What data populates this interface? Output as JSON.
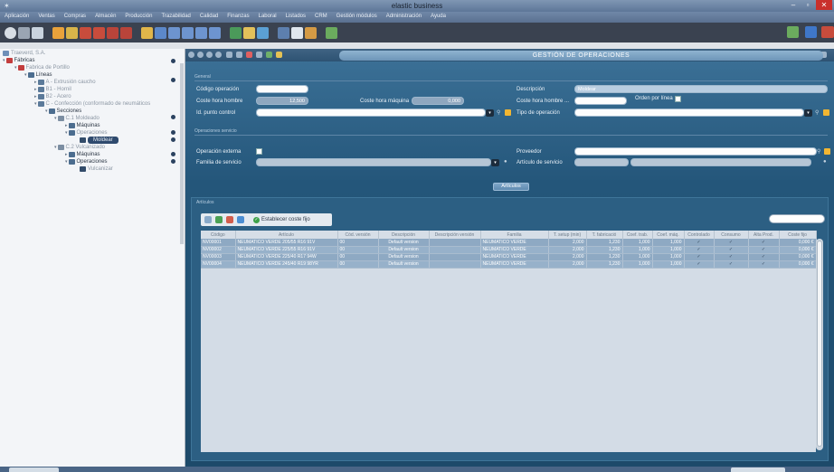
{
  "window": {
    "title": "elastic business",
    "logo_glyph": "✶",
    "minimize": "–",
    "maximize": "▫",
    "close": "✕"
  },
  "menu": [
    "Aplicación",
    "Ventas",
    "Compras",
    "Almacén",
    "Producción",
    "Trazabilidad",
    "Calidad",
    "Finanzas",
    "Laboral",
    "Listados",
    "CRM",
    "Gestión módulos",
    "Administración",
    "Ayuda"
  ],
  "tree": {
    "root": "Traeverd, S.A.",
    "fabricas": "Fábricas",
    "fabrica": "Fabrica de Portillo",
    "lineas": "Líneas",
    "linea_a": "A - Extrusión caucho",
    "linea_b1": "B1 - Hornil",
    "linea_b2": "B2 - Acero",
    "linea_c": "C - Confección (conformado de neumáticos",
    "secciones": "Secciones",
    "c1": "C.1 Moldeado",
    "maquinas1": "Máquinas",
    "operaciones1": "Operaciones",
    "moldear": "Moldear",
    "c2": "C.2 Vulcanizado",
    "maquinas2": "Máquinas",
    "operaciones2": "Operaciones",
    "vulcanizar": "Vulcanizar"
  },
  "panel": {
    "title": "GESTIÓN DE OPERACIONES"
  },
  "form": {
    "section_general": "General",
    "codigo_operacion_label": "Código operación",
    "codigo_operacion_value": "",
    "descripcion_label": "Descripción",
    "descripcion_value": "Moldear",
    "coste_hora_hombre_label": "Coste hora hombre",
    "coste_hora_hombre_value": "12,500",
    "coste_hora_maquina_label": "Coste hora máquina",
    "coste_hora_maquina_value": "0,000",
    "coste_hora_hombre2_label": "Coste hora hombre ...",
    "orden_por_linea_label": "Orden por línea",
    "id_punto_control_label": "Id. punto control",
    "tipo_operacion_label": "Tipo de operación",
    "section_servicio": "Operaciones servicio",
    "operacion_externa_label": "Operación externa",
    "proveedor_label": "Proveedor",
    "familia_servicio_label": "Familia de servicio",
    "articulo_servicio_label": "Artículo de servicio",
    "articulos_button": "Artículos"
  },
  "articulos": {
    "section": "Artículos",
    "establecer_coste_fijo": "Establecer coste fijo",
    "columns": [
      "Código",
      "Artículo",
      "Cód. versión",
      "Descripción",
      "Descripción versión",
      "Familia",
      "T. setup (min)",
      "T. fabricació",
      "Coef. trab.",
      "Coef. máq.",
      "Controlado",
      "Consumo",
      "Alta Prod.",
      "Coste fijo"
    ],
    "rows": [
      [
        "NV00001",
        "NEUMATICO VERDE 205/55 R16 91V",
        "00",
        "Default version",
        "",
        "NEUMATICO VERDE",
        "2,000",
        "1,230",
        "1,000",
        "1,000",
        "✓",
        "✓",
        "✓",
        "0,000 €"
      ],
      [
        "NV00002",
        "NEUMATICO VERDE 225/55 R16 91V",
        "00",
        "Default version",
        "",
        "NEUMATICO VERDE",
        "2,000",
        "1,230",
        "1,000",
        "1,000",
        "✓",
        "✓",
        "✓",
        "0,000 €"
      ],
      [
        "NV00003",
        "NEUMATICO VERDE 225/40 R17 94W",
        "00",
        "Default version",
        "",
        "NEUMATICO VERDE",
        "2,000",
        "1,230",
        "1,000",
        "1,000",
        "✓",
        "✓",
        "✓",
        "0,000 €"
      ],
      [
        "NV00004",
        "NEUMATICO VERDE 245/40 R19 98YR",
        "00",
        "Default version",
        "",
        "NEUMATICO VERDE",
        "2,000",
        "1,230",
        "1,000",
        "1,000",
        "✓",
        "✓",
        "✓",
        "0,000 €"
      ]
    ]
  },
  "colors": {
    "accent": "#2f4a6e",
    "content_bg": "#24567a",
    "grid_row": "#8ea9c3"
  }
}
